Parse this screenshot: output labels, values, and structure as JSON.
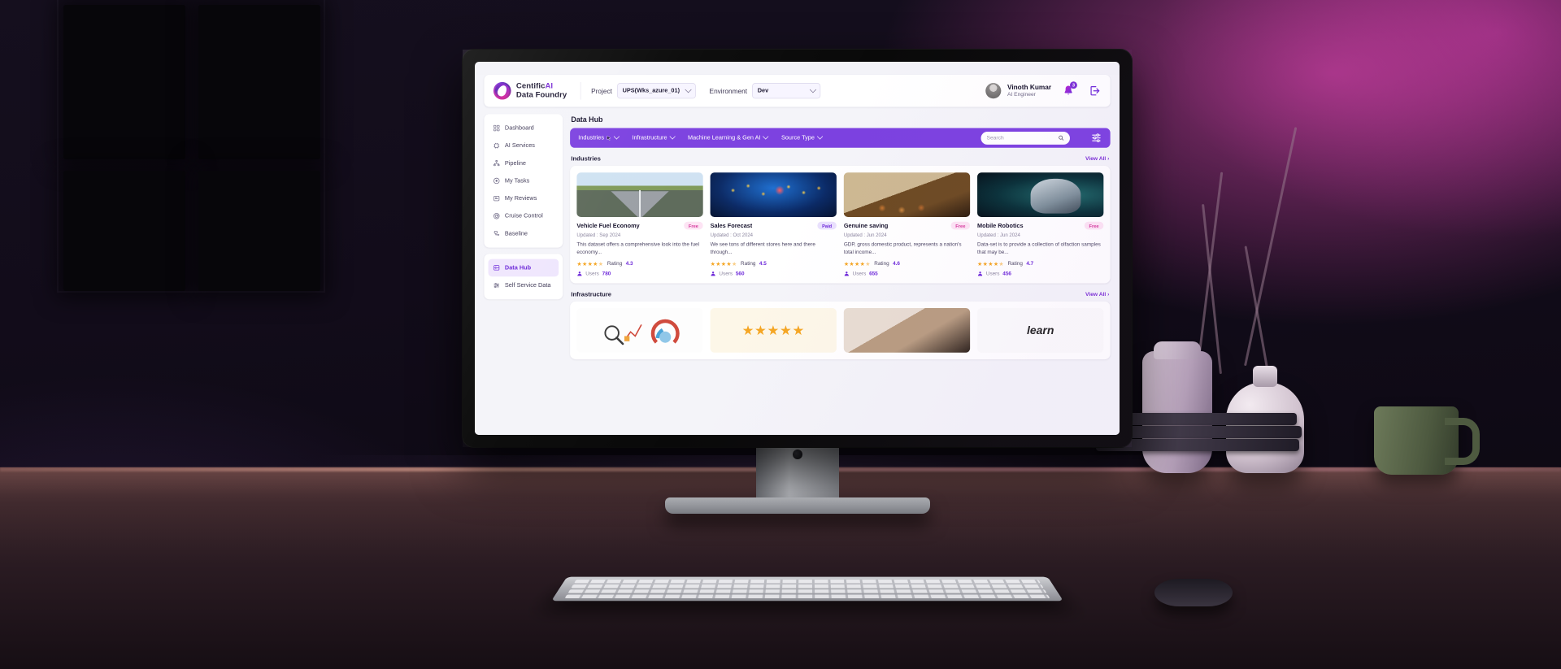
{
  "app": {
    "brand_line1": "Centific",
    "brand_line1_accent": "AI",
    "brand_line2": "Data Foundry",
    "page_title": "Data Hub"
  },
  "topbar": {
    "project_label": "Project",
    "project_value": "UPS(Wks_azure_01)",
    "environment_label": "Environment",
    "environment_value": "Dev",
    "user_name": "Vinoth Kumar",
    "user_role": "AI Engineer",
    "notification_count": "3",
    "logout_name": "logout-icon"
  },
  "sidebar": {
    "groups": [
      {
        "items": [
          {
            "label": "Dashboard",
            "icon": "dashboard-icon",
            "active": false
          },
          {
            "label": "AI Services",
            "icon": "ai-services-icon",
            "active": false
          },
          {
            "label": "Pipeline",
            "icon": "pipeline-icon",
            "active": false
          },
          {
            "label": "My Tasks",
            "icon": "my-tasks-icon",
            "active": false
          },
          {
            "label": "My Reviews",
            "icon": "my-reviews-icon",
            "active": false
          },
          {
            "label": "Cruise Control",
            "icon": "cruise-control-icon",
            "active": false
          },
          {
            "label": "Baseline",
            "icon": "baseline-icon",
            "active": false
          }
        ]
      },
      {
        "items": [
          {
            "label": "Data Hub",
            "icon": "data-hub-icon",
            "active": true
          },
          {
            "label": "Self Service Data",
            "icon": "self-service-data-icon",
            "active": false
          }
        ]
      }
    ]
  },
  "filterbar": {
    "filters": [
      {
        "label": "Industries"
      },
      {
        "label": "Infrastructure"
      },
      {
        "label": "Machine Learning & Gen AI"
      },
      {
        "label": "Source Type"
      }
    ],
    "search_placeholder": "Search",
    "search_value": "",
    "settings_icon": "sliders-icon"
  },
  "sections": [
    {
      "title": "Industries",
      "view_all": "View All",
      "cards": [
        {
          "title": "Vehicle Fuel Economy",
          "badge": "Free",
          "badge_type": "free",
          "updated": "Updated : Sep 2024",
          "description": "This dataset offers a comprehensive look into the fuel economy...",
          "stars": "★★★★",
          "rating_label": "Rating",
          "rating": "4.3",
          "users_label": "Users",
          "users": "780",
          "thumb": "t-road"
        },
        {
          "title": "Sales Forecast",
          "badge": "Paid",
          "badge_type": "paid",
          "updated": "Updated : Oct 2024",
          "description": "We see tons of different stores here and there through...",
          "stars": "★★★★",
          "rating_label": "Rating",
          "rating": "4.5",
          "users_label": "Users",
          "users": "560",
          "thumb": "t-emoji"
        },
        {
          "title": "Genuine saving",
          "badge": "Free",
          "badge_type": "free",
          "updated": "Updated : Jun 2024",
          "description": "GDP, gross domestic product, represents a nation's total income...",
          "stars": "★★★★",
          "rating_label": "Rating",
          "rating": "4.6",
          "users_label": "Users",
          "users": "655",
          "thumb": "t-coins"
        },
        {
          "title": "Mobile Robotics",
          "badge": "Free",
          "badge_type": "free",
          "updated": "Updated : Jun 2024",
          "description": "Data-set is to provide a collection of olfaction samples that may be...",
          "stars": "★★★★",
          "rating_label": "Rating",
          "rating": "4.7",
          "users_label": "Users",
          "users": "456",
          "thumb": "t-robot"
        }
      ]
    },
    {
      "title": "Infrastructure",
      "view_all": "View All",
      "cards": [
        {
          "title": "",
          "thumb": "t-analytics",
          "stars_art": ""
        },
        {
          "title": "",
          "thumb": "t-stars",
          "stars_art": "★★★★★"
        },
        {
          "title": "",
          "thumb": "t-hands",
          "stars_art": ""
        },
        {
          "title": "",
          "thumb": "t-learn",
          "stars_art": "learn"
        }
      ]
    }
  ],
  "colors": {
    "accent_purple": "#7b2fd6",
    "filterbar_purple": "#7c41e0",
    "free_pill_bg": "#fde4f4",
    "free_pill_text": "#d6379c",
    "paid_pill_bg": "#e9e0fd",
    "paid_pill_text": "#6d28d9",
    "star_gold": "#f5a623"
  }
}
